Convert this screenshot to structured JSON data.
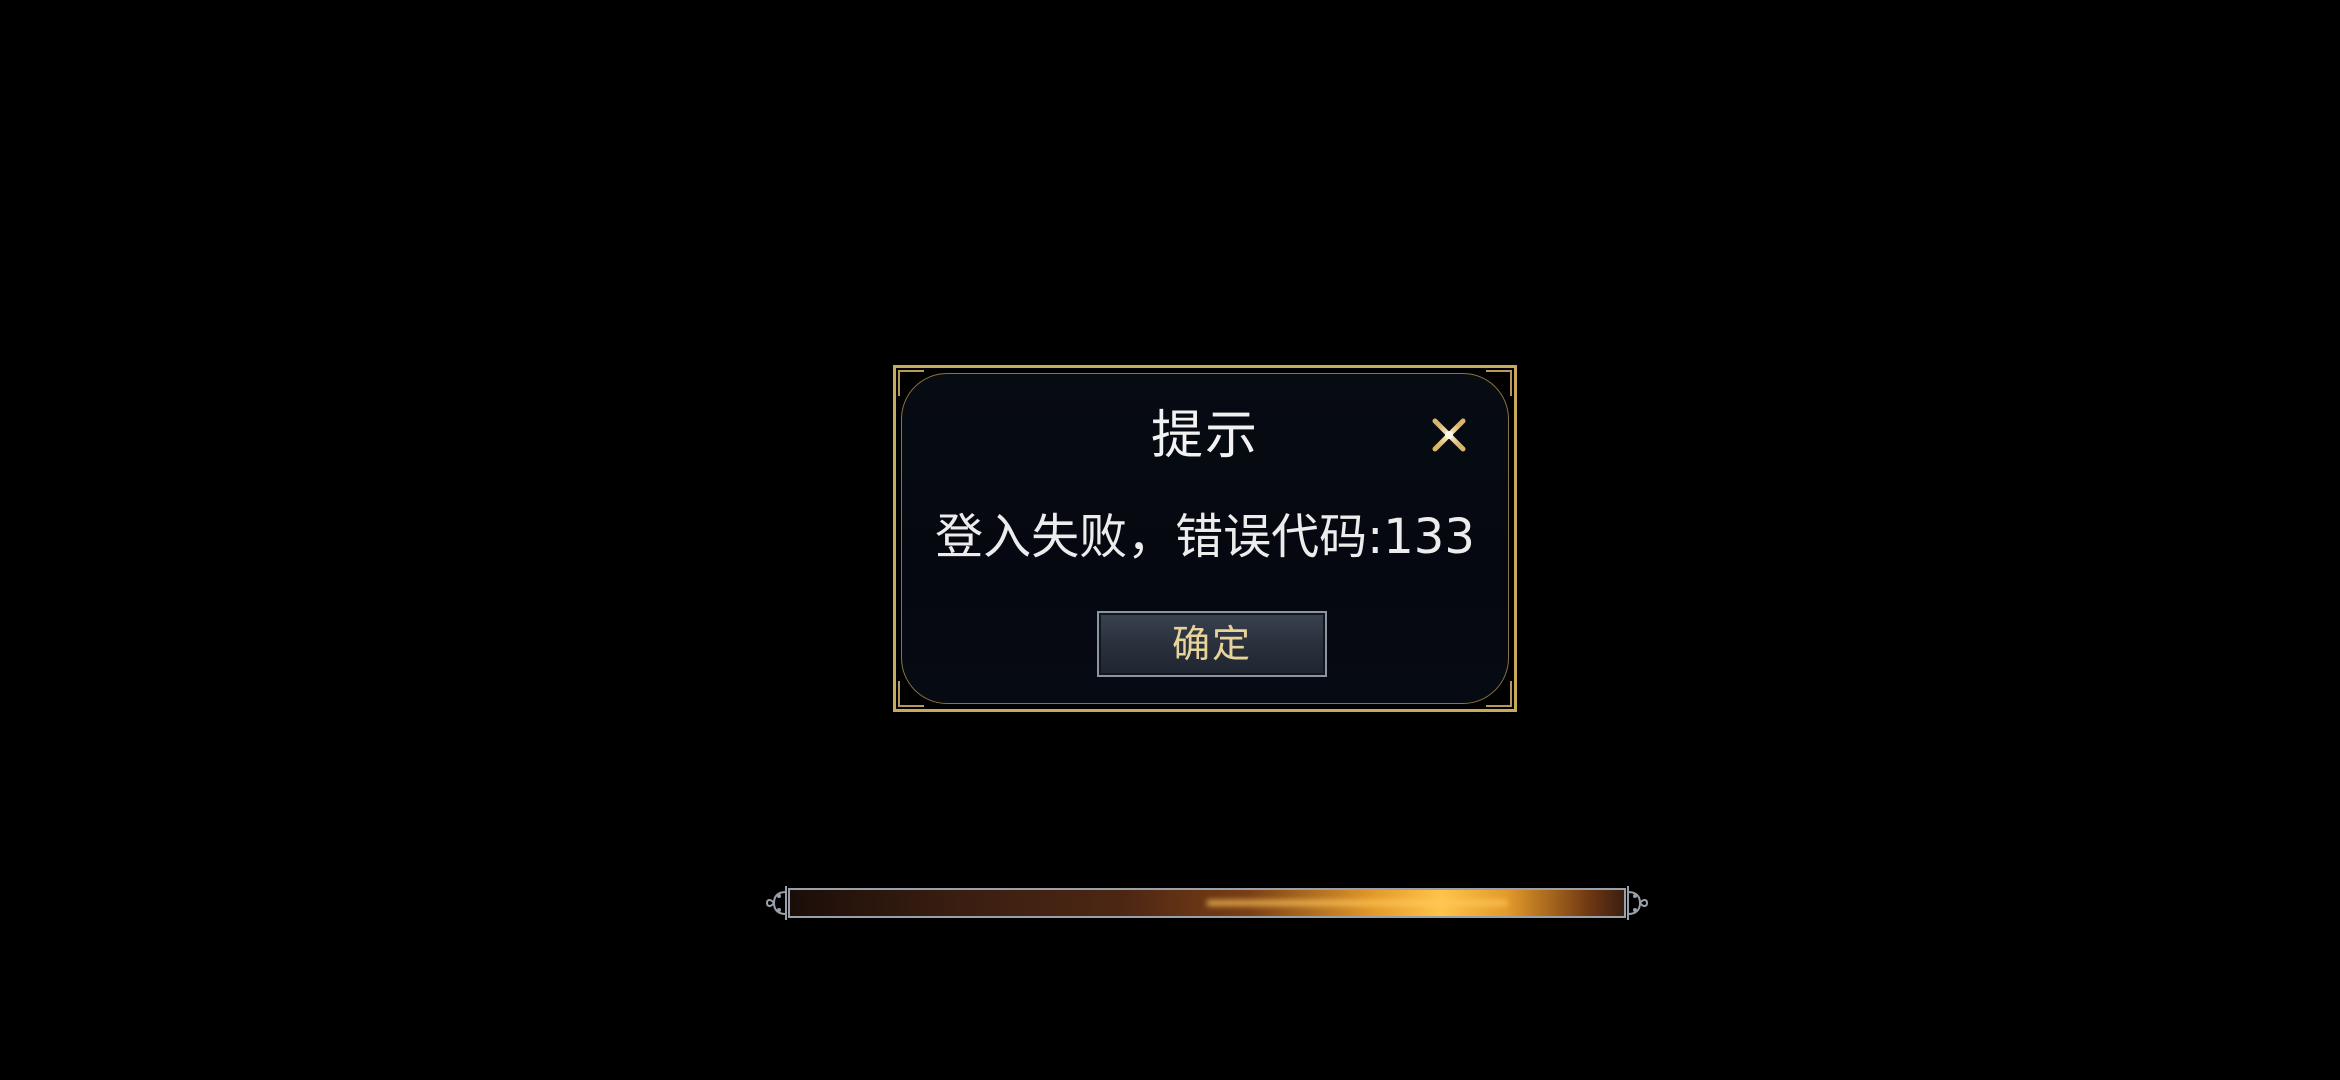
{
  "dialog": {
    "title": "提示",
    "message": "登入失败，错误代码:133",
    "confirm_label": "确定",
    "close_icon": "close-icon"
  },
  "loading": {
    "progress_fraction": 1.0
  },
  "colors": {
    "background": "#000000",
    "dialog_border": "#c9a95a",
    "dialog_fill": "#060a12",
    "button_text": "#e8d39a",
    "progress_glow": "#ffc44a"
  }
}
